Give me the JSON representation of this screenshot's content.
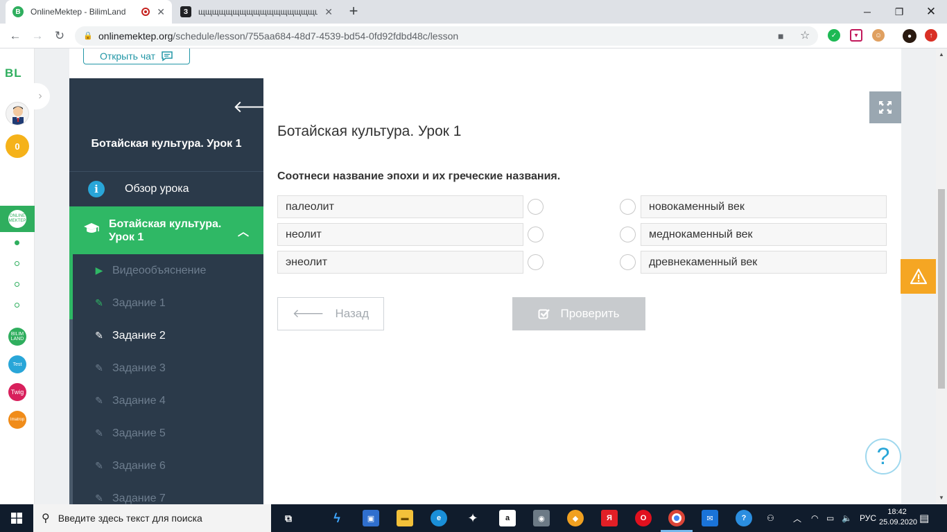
{
  "browser": {
    "tabs": [
      {
        "title": "OnlineMektep - BilimLand",
        "favicon_color": "#2fae5e",
        "favicon_letter": "B",
        "active": true
      },
      {
        "title": "щщщщщщщщщщщщщщщщщщщщщщщщ",
        "favicon_color": "#202124",
        "favicon_letter": "З",
        "active": false
      }
    ],
    "url_host": "onlinemektep.org",
    "url_path": "/schedule/lesson/755aa684-48d7-4539-bd54-0fd92fdbd48c/lesson"
  },
  "left_rail": {
    "logo": "BL",
    "points": "0",
    "green_app_label": "ONLINE MEKTEP",
    "apps": [
      {
        "label": "BILIM LAND",
        "color": "#2fae5e"
      },
      {
        "label": "Test",
        "color": "#29a6d8"
      },
      {
        "label": "Twig",
        "color": "#d8205c"
      },
      {
        "label": "Imatrop",
        "color": "#f08c1a"
      }
    ]
  },
  "chat_button": "Открыть чат",
  "sidebar": {
    "lesson_title": "Ботайская культура. Урок 1",
    "overview": "Обзор урока",
    "active_section": "Ботайская культура. Урок 1",
    "items": [
      {
        "label": "Видеообъяснение",
        "icon": "play-icon"
      },
      {
        "label": "Задание 1",
        "icon": "edit-icon"
      },
      {
        "label": "Задание 2",
        "icon": "edit-icon"
      },
      {
        "label": "Задание 3",
        "icon": "edit-icon"
      },
      {
        "label": "Задание 4",
        "icon": "edit-icon"
      },
      {
        "label": "Задание 5",
        "icon": "edit-icon"
      },
      {
        "label": "Задание 6",
        "icon": "edit-icon"
      },
      {
        "label": "Задание 7",
        "icon": "edit-icon"
      }
    ]
  },
  "main": {
    "title": "Ботайская культура. Урок 1",
    "question": "Соотнеси название эпохи и их греческие названия.",
    "left_options": [
      "палеолит",
      "неолит",
      "энеолит"
    ],
    "right_options": [
      "новокаменный век",
      "меднокаменный век",
      "древнекаменный век"
    ],
    "back_label": "Назад",
    "check_label": "Проверить"
  },
  "taskbar": {
    "search_placeholder": "Введите здесь текст для поиска",
    "language": "РУС",
    "time": "18:42",
    "date": "25.09.2020"
  },
  "colors": {
    "sidebar_bg": "#2b3a4a",
    "accent_green": "#2fb865",
    "warning_orange": "#f5a623",
    "info_blue": "#29a6d8"
  }
}
